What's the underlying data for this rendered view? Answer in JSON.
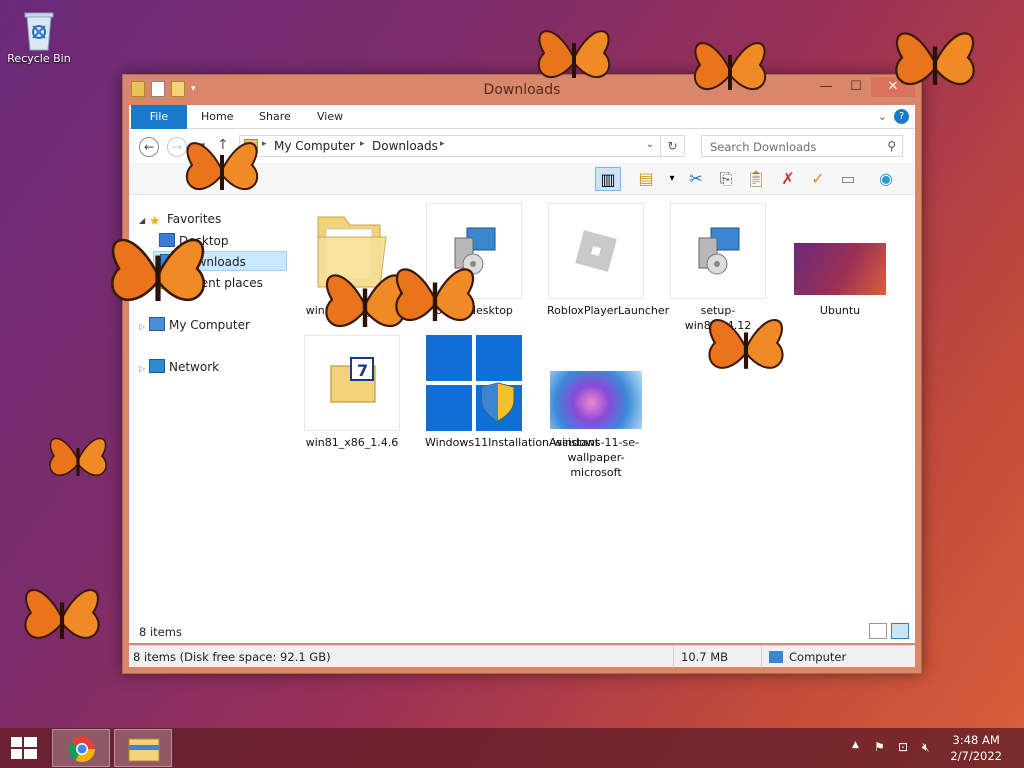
{
  "desktop": {
    "recycle_bin_label": "Recycle Bin"
  },
  "window": {
    "title": "Downloads",
    "ribbon": {
      "file": "File",
      "home": "Home",
      "share": "Share",
      "view": "View"
    },
    "address": {
      "crumbs": [
        "My Computer",
        "Downloads"
      ],
      "search_placeholder": "Search Downloads"
    },
    "nav": {
      "favorites": "Favorites",
      "desktop": "Desktop",
      "downloads": "Downloads",
      "recent_places": "Recent places",
      "my_computer": "My Computer",
      "network": "Network"
    },
    "files": [
      {
        "name": "win81_x86_1.4.6",
        "icon": "folder-icon"
      },
      {
        "name": "beyondesktop",
        "icon": "installer-icon"
      },
      {
        "name": "RobloxPlayerLauncher",
        "icon": "roblox-icon"
      },
      {
        "name": "setup-win8_1.4.12",
        "icon": "installer-icon"
      },
      {
        "name": "Ubuntu",
        "icon": "image-thumb"
      },
      {
        "name": "win81_x86_1.4.6",
        "icon": "7zip-archive-icon"
      },
      {
        "name": "Windows11InstallationAssistant",
        "icon": "windows-shield-icon"
      },
      {
        "name": "windows-11-se-wallpaper-microsoft",
        "icon": "image-thumb"
      }
    ],
    "status": {
      "item_count": "8 items",
      "summary": "8 items (Disk free space: 92.1 GB)",
      "size": "10.7 MB",
      "location": "Computer"
    }
  },
  "taskbar": {
    "time": "3:48 AM",
    "date": "2/7/2022"
  }
}
